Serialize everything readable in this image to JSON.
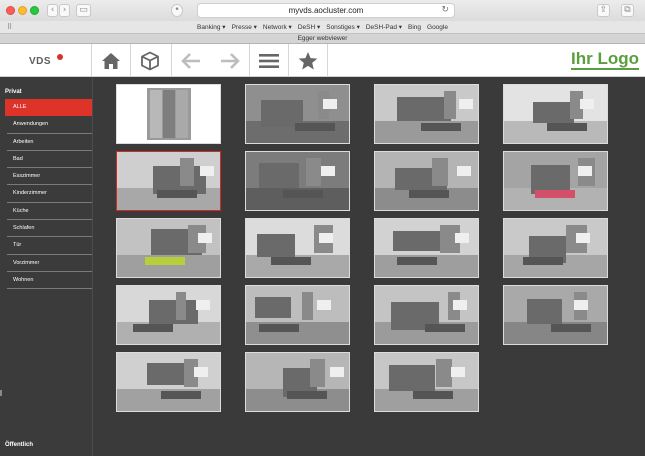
{
  "browser": {
    "url": "myvds.aocluster.com",
    "favorites": [
      "Banking ▾",
      "Presse ▾",
      "Network ▾",
      "DeSH ▾",
      "Sonstiges ▾",
      "DeSH-Pad ▾",
      "Bing",
      "Google"
    ],
    "tab_title": "Egger webviewer"
  },
  "header": {
    "brand": "VDS",
    "logo_text": "Ihr Logo",
    "tools": [
      "home-icon",
      "cube-icon",
      "arrow-left-icon",
      "arrow-right-icon",
      "menu-icon",
      "star-icon"
    ]
  },
  "sidebar": {
    "heading": "Privat",
    "items": [
      {
        "label": "ALLE",
        "active": true
      },
      {
        "label": "Anwendungen"
      },
      {
        "label": "Arbeiten"
      },
      {
        "label": "Bad"
      },
      {
        "label": "Esszimmer"
      },
      {
        "label": "Kinderzimmer"
      },
      {
        "label": "Küche"
      },
      {
        "label": "Schlafen"
      },
      {
        "label": "Tür"
      },
      {
        "label": "Vorzimmer"
      },
      {
        "label": "Wohnen"
      }
    ],
    "footer": "Öffentlich"
  },
  "gallery": {
    "selected_index": 4,
    "items": [
      {
        "scene": "sliding-wardrobe-doors",
        "wall": "#ffffff",
        "floor": "#ffffff"
      },
      {
        "scene": "display-shelf-unit",
        "wall": "#8f8f8f",
        "floor": "#6d6d6d"
      },
      {
        "scene": "office-desk-window",
        "wall": "#c9c9c9",
        "floor": "#9a9a9a"
      },
      {
        "scene": "office-attic",
        "wall": "#e3e3e3",
        "floor": "#b9b9b9"
      },
      {
        "scene": "bathroom-vanity",
        "wall": "#cfcfcf",
        "floor": "#a8a8a8"
      },
      {
        "scene": "living-shelves-dark",
        "wall": "#7c7c7c",
        "floor": "#5e5e5e"
      },
      {
        "scene": "dining-room",
        "wall": "#b4b4b4",
        "floor": "#8c8c8c"
      },
      {
        "scene": "kids-room-cushions",
        "wall": "#a4a4a4",
        "floor": "#b2b2b2"
      },
      {
        "scene": "living-room-green-chair",
        "wall": "#c2c2c2",
        "floor": "#9f9f9f"
      },
      {
        "scene": "kitchen-island",
        "wall": "#dcdcdc",
        "floor": "#a9a9a9"
      },
      {
        "scene": "kitchen-white",
        "wall": "#d2d2d2",
        "floor": "#9e9e9e"
      },
      {
        "scene": "bedroom-wardrobe",
        "wall": "#c9c9c9",
        "floor": "#a6a6a6"
      },
      {
        "scene": "bedroom-art",
        "wall": "#d8d8d8",
        "floor": "#b0b0b0"
      },
      {
        "scene": "doors-hallway",
        "wall": "#bdbdbd",
        "floor": "#8f8f8f"
      },
      {
        "scene": "room-easel",
        "wall": "#c4c4c4",
        "floor": "#9b9b9b"
      },
      {
        "scene": "living-tv-wall",
        "wall": "#a9a9a9",
        "floor": "#868686"
      },
      {
        "scene": "staircase-storage",
        "wall": "#d0d0d0",
        "floor": "#a1a1a1"
      },
      {
        "scene": "kitchen-galley",
        "wall": "#b6b6b6",
        "floor": "#8d8d8d"
      },
      {
        "scene": "living-room-sofa",
        "wall": "#c7c7c7",
        "floor": "#9f9f9f"
      }
    ]
  }
}
